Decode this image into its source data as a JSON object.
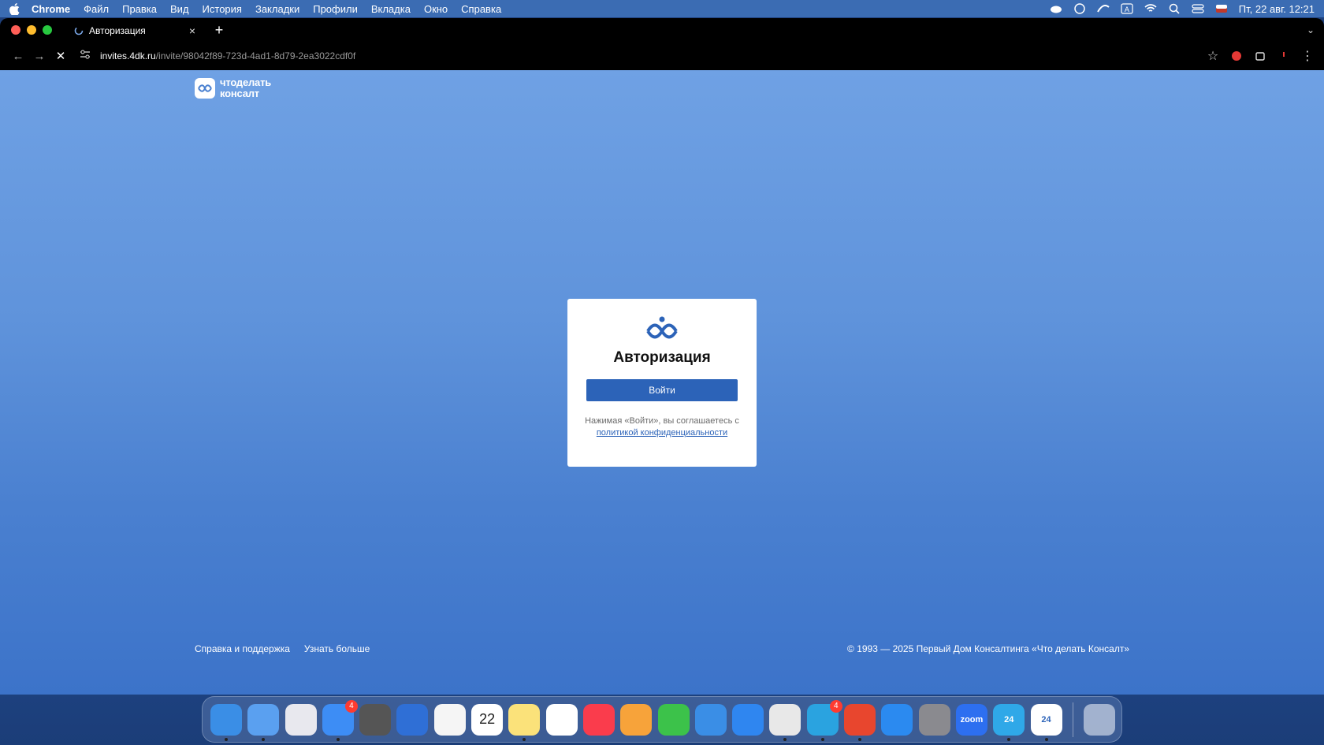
{
  "menubar": {
    "app_name": "Chrome",
    "items": [
      "Файл",
      "Правка",
      "Вид",
      "История",
      "Закладки",
      "Профили",
      "Вкладка",
      "Окно",
      "Справка"
    ],
    "clock": "Пт, 22 авг.  12:21"
  },
  "browser": {
    "tab_title": "Авторизация",
    "url_host": "invites.4dk.ru",
    "url_path": "/invite/98042f89-723d-4ad1-8d79-2ea3022cdf0f"
  },
  "brand": {
    "line1": "чтоделать",
    "line2": "консалт"
  },
  "auth": {
    "title": "Авторизация",
    "login_button": "Войти",
    "consent_text": "Нажимая «Войти», вы соглашаетесь с",
    "privacy_link": "политикой конфиденциальности"
  },
  "footer": {
    "links": [
      "Справка и поддержка",
      "Узнать больше"
    ],
    "copyright": "© 1993 — 2025 Первый Дом Консалтинга «Что делать Консалт»"
  },
  "dock": {
    "apps": [
      {
        "name": "finder",
        "color": "#3a8ee6",
        "label": "",
        "badge": "",
        "running": true
      },
      {
        "name": "freeform-app",
        "color": "#5aa0f0",
        "label": "",
        "badge": "",
        "running": true
      },
      {
        "name": "launchpad",
        "color": "#e8e8ee",
        "label": "",
        "badge": "",
        "running": false
      },
      {
        "name": "mail",
        "color": "#3d8df5",
        "label": "",
        "badge": "4",
        "running": true
      },
      {
        "name": "calculator",
        "color": "#555555",
        "label": "",
        "badge": "",
        "running": false
      },
      {
        "name": "iphone-mirroring",
        "color": "#2f6fd6",
        "label": "",
        "badge": "",
        "running": false
      },
      {
        "name": "photos",
        "color": "#f5f5f5",
        "label": "",
        "badge": "",
        "running": false
      },
      {
        "name": "calendar",
        "color": "#ffffff",
        "label": "22",
        "badge": "",
        "running": false
      },
      {
        "name": "notes",
        "color": "#fbe27a",
        "label": "",
        "badge": "",
        "running": true
      },
      {
        "name": "freeform",
        "color": "#ffffff",
        "label": "",
        "badge": "",
        "running": false
      },
      {
        "name": "music",
        "color": "#fa3c4c",
        "label": "",
        "badge": "",
        "running": false
      },
      {
        "name": "pages",
        "color": "#f7a33a",
        "label": "",
        "badge": "",
        "running": false
      },
      {
        "name": "numbers",
        "color": "#3cc24a",
        "label": "",
        "badge": "",
        "running": false
      },
      {
        "name": "keynote",
        "color": "#3a8ee6",
        "label": "",
        "badge": "",
        "running": false
      },
      {
        "name": "safari",
        "color": "#2f86f0",
        "label": "",
        "badge": "",
        "running": false
      },
      {
        "name": "chrome",
        "color": "#e8e8e8",
        "label": "",
        "badge": "",
        "running": true
      },
      {
        "name": "telegram",
        "color": "#2aa3e0",
        "label": "",
        "badge": "4",
        "running": true
      },
      {
        "name": "anydesk",
        "color": "#e8462e",
        "label": "",
        "badge": "",
        "running": true
      },
      {
        "name": "app-store",
        "color": "#2b8af0",
        "label": "",
        "badge": "",
        "running": false
      },
      {
        "name": "system-settings",
        "color": "#8a8a8f",
        "label": "",
        "badge": "",
        "running": false
      },
      {
        "name": "zoom",
        "color": "#2d6ff0",
        "label": "zoom",
        "badge": "",
        "running": false
      },
      {
        "name": "bitrix24-blue",
        "color": "#2fa8e8",
        "label": "24",
        "badge": "",
        "running": true
      },
      {
        "name": "bitrix24-white",
        "color": "#ffffff",
        "label": "24",
        "badge": "",
        "running": true
      }
    ]
  }
}
